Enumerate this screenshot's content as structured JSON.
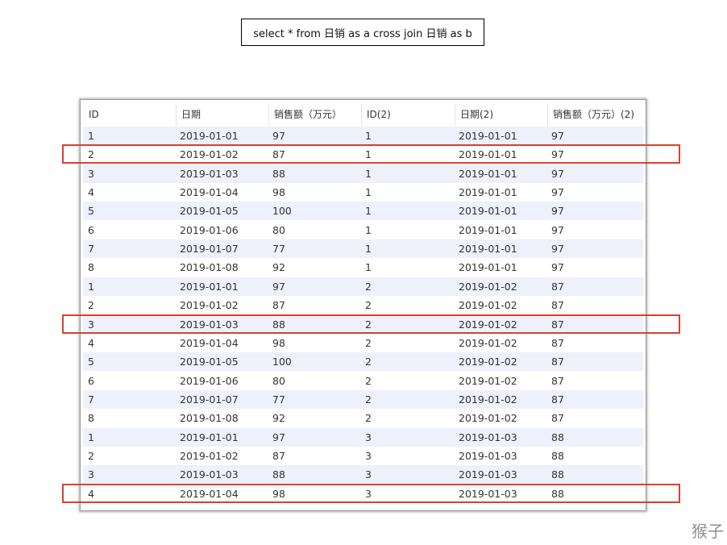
{
  "sql": "select * from 日销 as a cross join 日销 as b",
  "columns": [
    "ID",
    "日期",
    "销售额（万元）",
    "ID(2)",
    "日期(2)",
    "销售额（万元）(2)"
  ],
  "rows": [
    [
      "1",
      "2019-01-01",
      "97",
      "1",
      "2019-01-01",
      "97"
    ],
    [
      "2",
      "2019-01-02",
      "87",
      "1",
      "2019-01-01",
      "97"
    ],
    [
      "3",
      "2019-01-03",
      "88",
      "1",
      "2019-01-01",
      "97"
    ],
    [
      "4",
      "2019-01-04",
      "98",
      "1",
      "2019-01-01",
      "97"
    ],
    [
      "5",
      "2019-01-05",
      "100",
      "1",
      "2019-01-01",
      "97"
    ],
    [
      "6",
      "2019-01-06",
      "80",
      "1",
      "2019-01-01",
      "97"
    ],
    [
      "7",
      "2019-01-07",
      "77",
      "1",
      "2019-01-01",
      "97"
    ],
    [
      "8",
      "2019-01-08",
      "92",
      "1",
      "2019-01-01",
      "97"
    ],
    [
      "1",
      "2019-01-01",
      "97",
      "2",
      "2019-01-02",
      "87"
    ],
    [
      "2",
      "2019-01-02",
      "87",
      "2",
      "2019-01-02",
      "87"
    ],
    [
      "3",
      "2019-01-03",
      "88",
      "2",
      "2019-01-02",
      "87"
    ],
    [
      "4",
      "2019-01-04",
      "98",
      "2",
      "2019-01-02",
      "87"
    ],
    [
      "5",
      "2019-01-05",
      "100",
      "2",
      "2019-01-02",
      "87"
    ],
    [
      "6",
      "2019-01-06",
      "80",
      "2",
      "2019-01-02",
      "87"
    ],
    [
      "7",
      "2019-01-07",
      "77",
      "2",
      "2019-01-02",
      "87"
    ],
    [
      "8",
      "2019-01-08",
      "92",
      "2",
      "2019-01-02",
      "87"
    ],
    [
      "1",
      "2019-01-01",
      "97",
      "3",
      "2019-01-03",
      "88"
    ],
    [
      "2",
      "2019-01-02",
      "87",
      "3",
      "2019-01-03",
      "88"
    ],
    [
      "3",
      "2019-01-03",
      "88",
      "3",
      "2019-01-03",
      "88"
    ],
    [
      "4",
      "2019-01-04",
      "98",
      "3",
      "2019-01-03",
      "88"
    ]
  ],
  "highlighted_rows": [
    1,
    10,
    19
  ],
  "highlight_color": "#d9412e",
  "stripe_color": "#eef0fb",
  "watermark": "猴子"
}
